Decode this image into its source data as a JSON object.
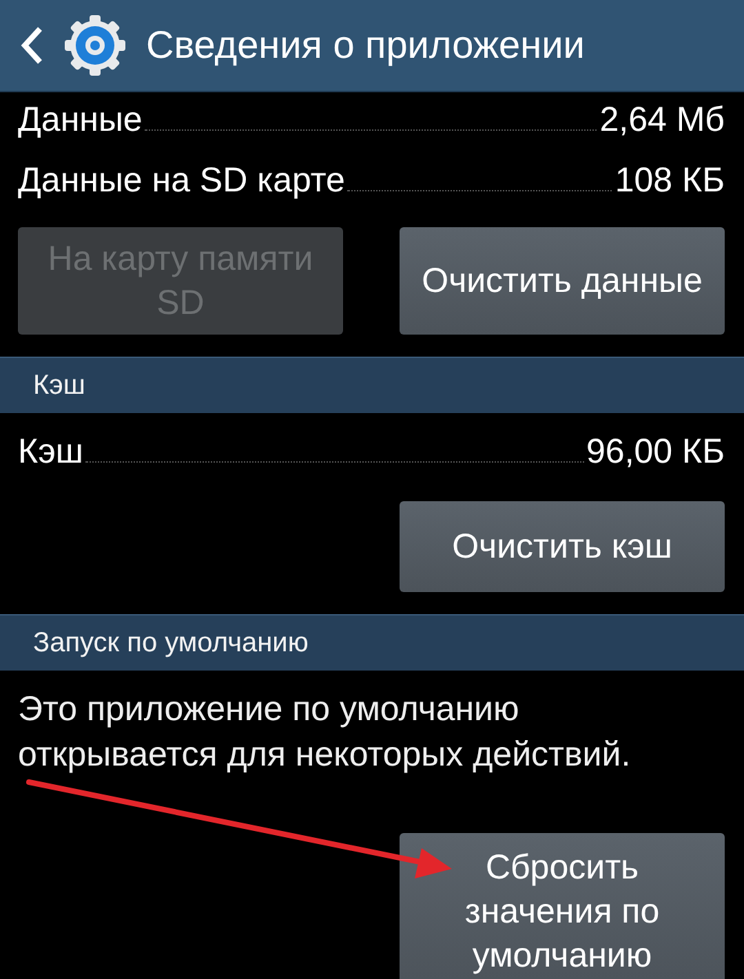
{
  "action_bar": {
    "title": "Сведения о приложении"
  },
  "sections": [
    {
      "kind": "storage",
      "rows": [
        {
          "label": "Данные",
          "value": "2,64 Мб"
        },
        {
          "label": "Данные на SD карте",
          "value": "108 КБ"
        }
      ],
      "buttons": [
        {
          "label": "На карту памяти SD",
          "disabled": true
        },
        {
          "label": "Очистить данные",
          "disabled": false
        }
      ]
    },
    {
      "kind": "cache",
      "header": "Кэш",
      "rows": [
        {
          "label": "Кэш",
          "value": "96,00 КБ"
        }
      ],
      "buttons": [
        {
          "label": "Очистить кэш",
          "disabled": false
        }
      ]
    },
    {
      "kind": "defaults",
      "header": "Запуск по умолчанию",
      "text": "Это приложение по умолчанию открывается для некоторых действий.",
      "buttons": [
        {
          "label": "Сбросить значения по умолчанию",
          "disabled": false
        }
      ]
    }
  ]
}
